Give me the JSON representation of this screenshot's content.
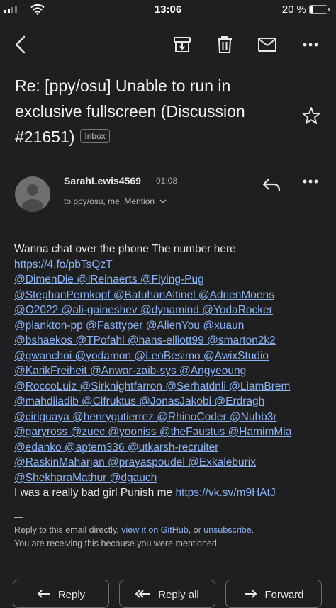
{
  "status_bar": {
    "time": "13:06",
    "battery": "20 %",
    "battery_level": 0.2
  },
  "toolbar": {
    "back_icon": "arrow-back-icon",
    "archive_icon": "archive-icon",
    "delete_icon": "trash-icon",
    "mark_icon": "mail-icon",
    "more_icon": "more-horiz-icon"
  },
  "email": {
    "subject_lines": [
      "Re: [ppy/osu] Unable to run in",
      "exclusive fullscreen (Discussion",
      "#21651)"
    ],
    "label": "Inbox",
    "sender": "SarahLewis4569",
    "time": "01:08",
    "recipients": "to ppy/osu, me, Mention",
    "body_lines": [
      {
        "type": "text",
        "text": "Wanna chat over the phone The number here"
      },
      {
        "type": "link",
        "text": "https://4.fo/pbTsQzT"
      },
      {
        "type": "link",
        "text": "@DimenDie @lReinaerts @Flying-Pug"
      },
      {
        "type": "link",
        "text": "@StephanPernkopf @BatuhanAltinel @AdrienMoens"
      },
      {
        "type": "link",
        "text": "@O2022 @ali-gaineshev @dynamind @YodaRocker"
      },
      {
        "type": "link",
        "text": "@plankton-pp @Fasttyper @AlienYou @xuaun"
      },
      {
        "type": "link",
        "text": "@bshaekos @TPofahl @hans-elliott99 @smarton2k2"
      },
      {
        "type": "link",
        "text": "@gwanchoi @yodamon @LeoBesimo @AwixStudio"
      },
      {
        "type": "link",
        "text": "@KarikFreiheit @Anwar-zaib-sys @Angyeoung"
      },
      {
        "type": "link",
        "text": "@RoccoLuiz @Sirknightfarron @Serhatdnli @LiamBrem"
      },
      {
        "type": "link",
        "text": "@mahdiiadib @Cifruktus @JonasJakobi @Erdragh"
      },
      {
        "type": "link",
        "text": "@ciriguaya @henrygutierrez @RhinoCoder @Nubb3r"
      },
      {
        "type": "link",
        "text": "@garyross @zuec @yooniss @theFaustus @HamimMia"
      },
      {
        "type": "link",
        "text": "@edanko @aptem336 @utkarsh-recruiter"
      },
      {
        "type": "link",
        "text": "@RaskinMaharjan @prayaspoudel @Exkaleburix"
      },
      {
        "type": "link",
        "text": "@ShekharaMathur @dgauch"
      }
    ],
    "closing_text": "I was a really bad girl Punish me ",
    "closing_link": "https://vk.sv/m9HAtJ",
    "separator": "—",
    "footer": {
      "part1": "Reply to this email directly, ",
      "github_link": "view it on GitHub",
      "part2": ", or ",
      "unsubscribe_link": "unsubscribe",
      "part3": ".",
      "line2": "You are receiving this because you were mentioned."
    }
  },
  "actions": {
    "reply": "Reply",
    "reply_all": "Reply all",
    "forward": "Forward"
  },
  "colors": {
    "background": "#1f1f1f",
    "link": "#8ab4f8",
    "text": "#e8e8e8"
  }
}
